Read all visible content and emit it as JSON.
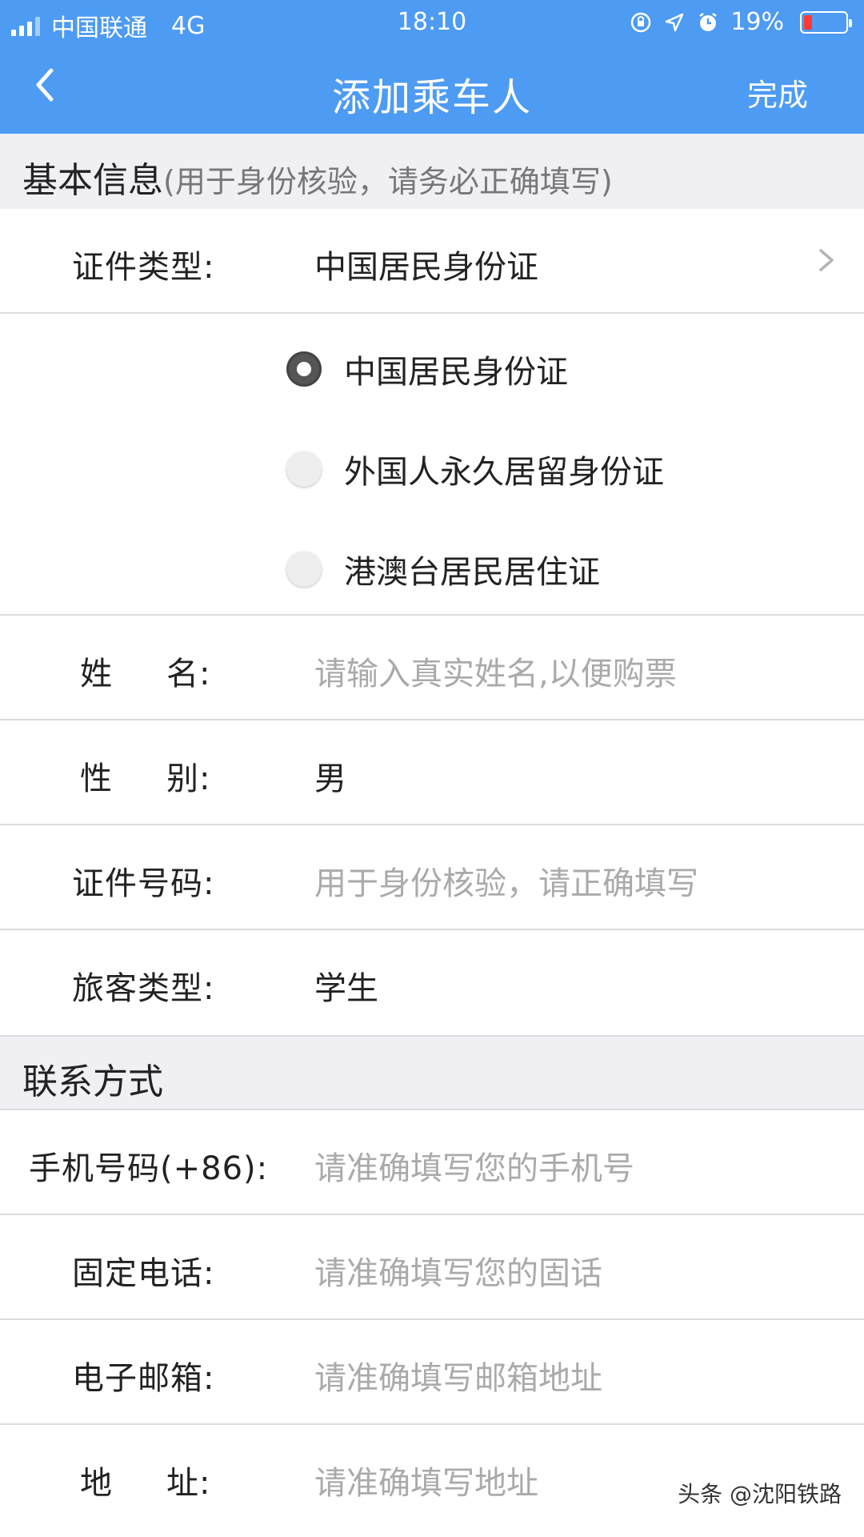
{
  "status_bar": {
    "carrier": "中国联通",
    "network": "4G",
    "time": "18:10",
    "battery": "19%",
    "battery_level": 0.19,
    "icons": [
      "orientation-lock-icon",
      "location-icon",
      "alarm-icon"
    ]
  },
  "nav": {
    "title": "添加乘车人",
    "done_label": "完成"
  },
  "basic_section": {
    "title": "基本信息",
    "subtitle": "(用于身份核验，请务必正确填写)"
  },
  "id_type": {
    "label": "证件类型:",
    "value": "中国居民身份证",
    "options": [
      {
        "label": "中国居民身份证",
        "selected": true
      },
      {
        "label": "外国人永久居留身份证",
        "selected": false
      },
      {
        "label": "港澳台居民居住证",
        "selected": false
      }
    ]
  },
  "name": {
    "label_1": "姓",
    "label_2": "名:",
    "placeholder": "请输入真实姓名,以便购票"
  },
  "gender": {
    "label_1": "性",
    "label_2": "别:",
    "value": "男"
  },
  "id_number": {
    "label": "证件号码:",
    "placeholder": "用于身份核验，请正确填写"
  },
  "passenger_type": {
    "label": "旅客类型:",
    "value": "学生"
  },
  "contact_section": {
    "title": "联系方式"
  },
  "mobile": {
    "label": "手机号码(+86):",
    "placeholder": "请准确填写您的手机号"
  },
  "landline": {
    "label": "固定电话:",
    "placeholder": "请准确填写您的固话"
  },
  "email": {
    "label": "电子邮箱:",
    "placeholder": "请准确填写邮箱地址"
  },
  "address": {
    "label_1": "地",
    "label_2": "址:",
    "placeholder": "请准确填写地址"
  },
  "watermark": "头条 @沈阳铁路",
  "colors": {
    "header_blue": "#4d9bf3",
    "section_gray": "#efeff4",
    "placeholder": "#aaaaaa"
  }
}
